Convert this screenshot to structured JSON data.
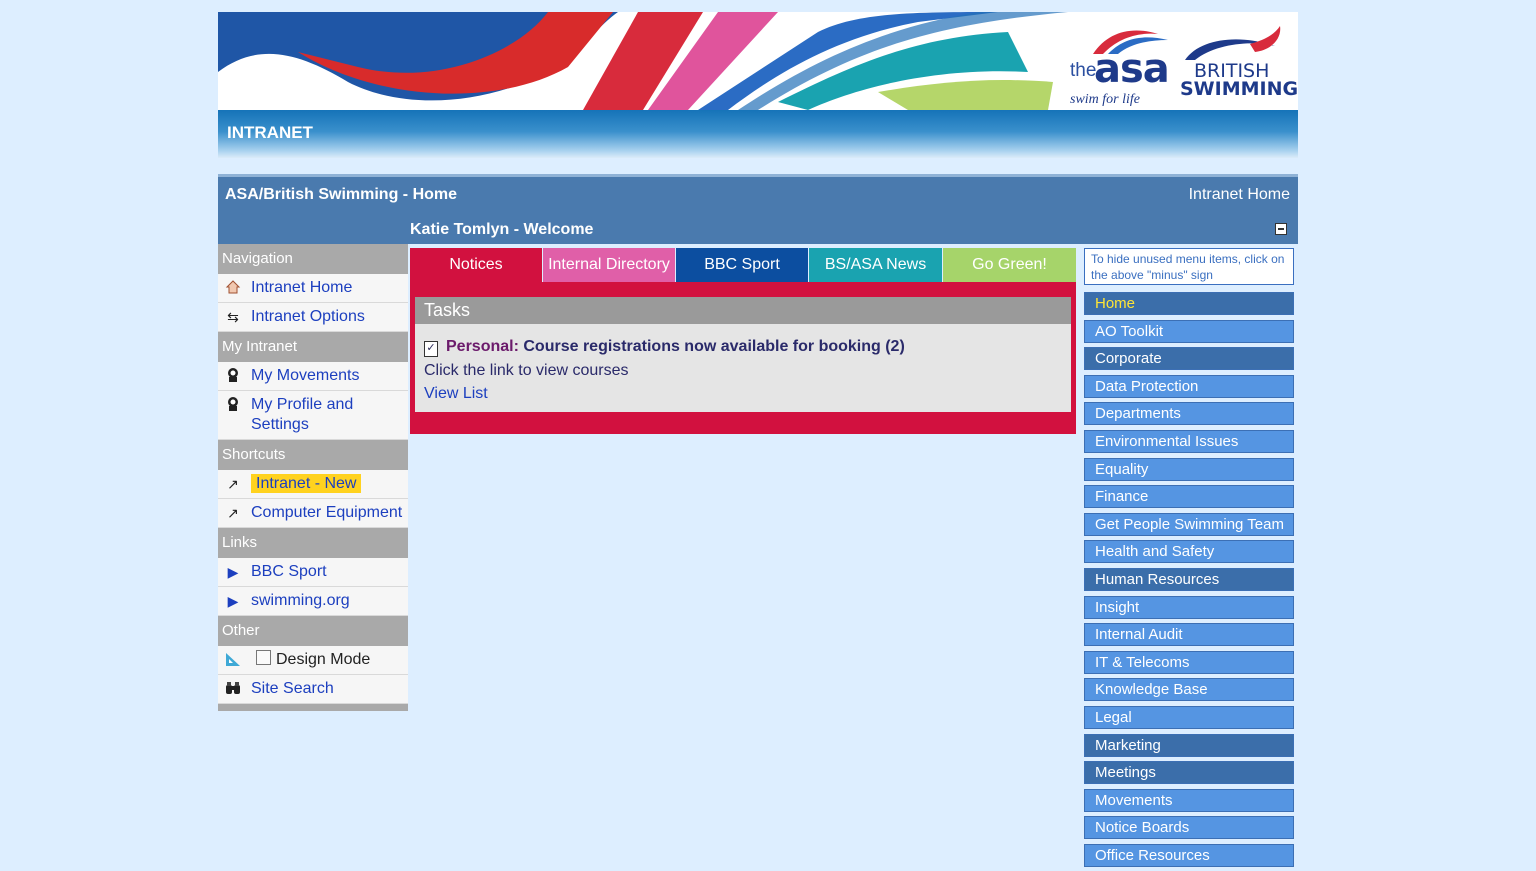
{
  "banner": {
    "asa_the": "the",
    "asa_name": "asa",
    "asa_tagline": "swim for life",
    "bs_line1": "BRITISH",
    "bs_line2": "SWIMMING"
  },
  "intranet_label": "INTRANET",
  "header": {
    "site_title": "ASA/British Swimming - Home",
    "home_link": "Intranet Home",
    "welcome": "Katie Tomlyn - Welcome"
  },
  "left_nav": {
    "navigation": {
      "heading": "Navigation",
      "items": [
        {
          "label": "Intranet Home",
          "icon": "home-icon"
        },
        {
          "label": "Intranet Options",
          "icon": "options-icon"
        }
      ]
    },
    "my_intranet": {
      "heading": "My Intranet",
      "items": [
        {
          "label": "My Movements",
          "icon": "person-icon"
        },
        {
          "label": "My Profile and Settings",
          "icon": "person-icon"
        }
      ]
    },
    "shortcuts": {
      "heading": "Shortcuts",
      "items": [
        {
          "label": "Intranet - New",
          "icon": "shortcut-arrow-icon",
          "highlight": "#ffd21f"
        },
        {
          "label": "Computer Equipment",
          "icon": "shortcut-arrow-icon"
        }
      ]
    },
    "links": {
      "heading": "Links",
      "items": [
        {
          "label": "BBC Sport",
          "icon": "arrow-right-icon"
        },
        {
          "label": "swimming.org",
          "icon": "arrow-right-icon"
        }
      ]
    },
    "other": {
      "heading": "Other",
      "items": [
        {
          "label": "Design Mode",
          "icon": "design-icon",
          "checked": false
        },
        {
          "label": "Site Search",
          "icon": "binoculars-icon"
        }
      ]
    }
  },
  "tabs": [
    {
      "label": "Notices",
      "color": "#d2113f"
    },
    {
      "label": "Internal Directory",
      "color": "#e05fa8"
    },
    {
      "label": "BBC Sport",
      "color": "#0c4ea0"
    },
    {
      "label": "BS/ASA News",
      "color": "#1aa3b0"
    },
    {
      "label": "Go Green!",
      "color": "#a6d46a"
    }
  ],
  "tasks": {
    "heading": "Tasks",
    "category": "Personal:",
    "message": "Course registrations now available for booking (2)",
    "subtext": "Click the link to view courses",
    "link": "View List"
  },
  "right_panel": {
    "hint": "To hide unused menu items, click on the above \"minus\" sign",
    "items": [
      {
        "label": "Home",
        "style": "active"
      },
      {
        "label": "AO Toolkit",
        "style": "light"
      },
      {
        "label": "Corporate",
        "style": "dark"
      },
      {
        "label": "Data Protection",
        "style": "light"
      },
      {
        "label": "Departments",
        "style": "light"
      },
      {
        "label": "Environmental Issues",
        "style": "light"
      },
      {
        "label": "Equality",
        "style": "light"
      },
      {
        "label": "Finance",
        "style": "light"
      },
      {
        "label": "Get People Swimming Team",
        "style": "light"
      },
      {
        "label": "Health and Safety",
        "style": "light"
      },
      {
        "label": "Human Resources",
        "style": "dark"
      },
      {
        "label": "Insight",
        "style": "light"
      },
      {
        "label": "Internal Audit",
        "style": "light"
      },
      {
        "label": "IT & Telecoms",
        "style": "light"
      },
      {
        "label": "Knowledge Base",
        "style": "light"
      },
      {
        "label": "Legal",
        "style": "light"
      },
      {
        "label": "Marketing",
        "style": "dark"
      },
      {
        "label": "Meetings",
        "style": "dark"
      },
      {
        "label": "Movements",
        "style": "light"
      },
      {
        "label": "Notice Boards",
        "style": "light"
      },
      {
        "label": "Office Resources",
        "style": "light"
      }
    ]
  }
}
